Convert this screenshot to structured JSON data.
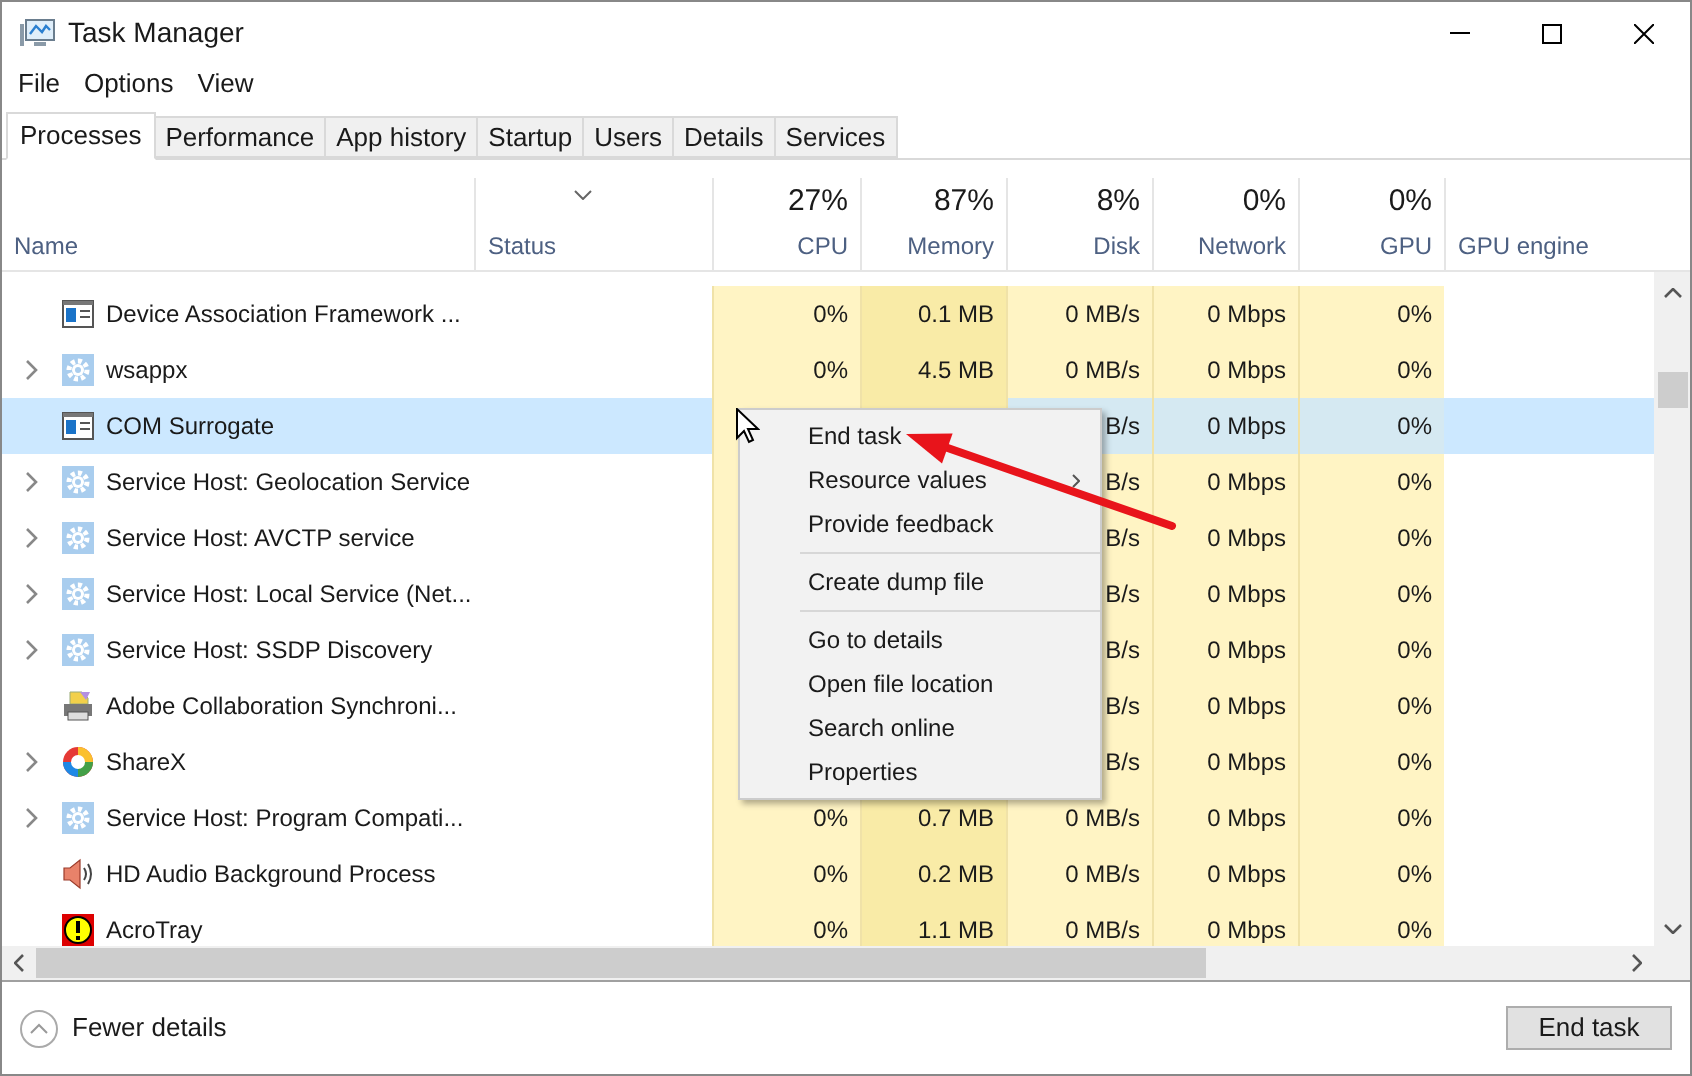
{
  "window": {
    "title": "Task Manager"
  },
  "menu_bar": [
    "File",
    "Options",
    "View"
  ],
  "tabs": [
    {
      "label": "Processes",
      "selected": true
    },
    {
      "label": "Performance",
      "selected": false
    },
    {
      "label": "App history",
      "selected": false
    },
    {
      "label": "Startup",
      "selected": false
    },
    {
      "label": "Users",
      "selected": false
    },
    {
      "label": "Details",
      "selected": false
    },
    {
      "label": "Services",
      "selected": false
    }
  ],
  "table": {
    "columns": [
      {
        "label": "Name",
        "sorted": false
      },
      {
        "label": "Status",
        "sorted": true
      },
      {
        "label": "CPU",
        "usage": "27%",
        "sorted": false
      },
      {
        "label": "Memory",
        "usage": "87%",
        "sorted": false
      },
      {
        "label": "Disk",
        "usage": "8%",
        "sorted": false
      },
      {
        "label": "Network",
        "usage": "0%",
        "sorted": false
      },
      {
        "label": "GPU",
        "usage": "0%",
        "sorted": false
      },
      {
        "label": "GPU engine",
        "sorted": false
      }
    ],
    "rows": [
      {
        "name": "Device Association Framework ...",
        "kind": "window",
        "expandable": false,
        "selected": false,
        "cells": [
          "0%",
          "0.1 MB",
          "0 MB/s",
          "0 Mbps",
          "0%"
        ]
      },
      {
        "name": "wsappx",
        "kind": "gear",
        "expandable": true,
        "selected": false,
        "cells": [
          "0%",
          "4.5 MB",
          "0 MB/s",
          "0 Mbps",
          "0%"
        ]
      },
      {
        "name": "COM Surrogate",
        "kind": "window",
        "expandable": false,
        "selected": true,
        "cells": [
          "B/s",
          "0 Mbps",
          "0%"
        ]
      },
      {
        "name": "Service Host: Geolocation Service",
        "kind": "gear",
        "expandable": true,
        "selected": false,
        "cells": [
          "B/s",
          "0 Mbps",
          "0%"
        ]
      },
      {
        "name": "Service Host: AVCTP service",
        "kind": "gear",
        "expandable": true,
        "selected": false,
        "cells": [
          "B/s",
          "0 Mbps",
          "0%"
        ]
      },
      {
        "name": "Service Host: Local Service (Net...",
        "kind": "gear",
        "expandable": true,
        "selected": false,
        "cells": [
          "B/s",
          "0 Mbps",
          "0%"
        ]
      },
      {
        "name": "Service Host: SSDP Discovery",
        "kind": "gear",
        "expandable": true,
        "selected": false,
        "cells": [
          "B/s",
          "0 Mbps",
          "0%"
        ]
      },
      {
        "name": "Adobe Collaboration Synchroni...",
        "kind": "printer",
        "expandable": false,
        "selected": false,
        "cells": [
          "B/s",
          "0 Mbps",
          "0%"
        ]
      },
      {
        "name": "ShareX",
        "kind": "ring",
        "expandable": true,
        "selected": false,
        "cells": [
          "B/s",
          "0 Mbps",
          "0%"
        ]
      },
      {
        "name": "Service Host: Program Compati...",
        "kind": "gear",
        "expandable": true,
        "selected": false,
        "cells": [
          "0%",
          "0.7 MB",
          "0 MB/s",
          "0 Mbps",
          "0%"
        ]
      },
      {
        "name": "HD Audio Background Process",
        "kind": "speaker",
        "expandable": false,
        "selected": false,
        "cells": [
          "0%",
          "0.2 MB",
          "0 MB/s",
          "0 Mbps",
          "0%"
        ]
      },
      {
        "name": "AcroTray",
        "kind": "alert",
        "expandable": false,
        "selected": false,
        "cells": [
          "0%",
          "1.1 MB",
          "0 MB/s",
          "0 Mbps",
          "0%"
        ]
      }
    ]
  },
  "context_menu": {
    "groups": [
      [
        {
          "label": "End task",
          "submenu": false
        },
        {
          "label": "Resource values",
          "submenu": true
        },
        {
          "label": "Provide feedback",
          "submenu": false
        }
      ],
      [
        {
          "label": "Create dump file",
          "submenu": false
        }
      ],
      [
        {
          "label": "Go to details",
          "submenu": false
        },
        {
          "label": "Open file location",
          "submenu": false
        },
        {
          "label": "Search online",
          "submenu": false
        },
        {
          "label": "Properties",
          "submenu": false
        }
      ]
    ]
  },
  "footer": {
    "details_toggle": "Fewer details",
    "end_task_button": "End task"
  }
}
